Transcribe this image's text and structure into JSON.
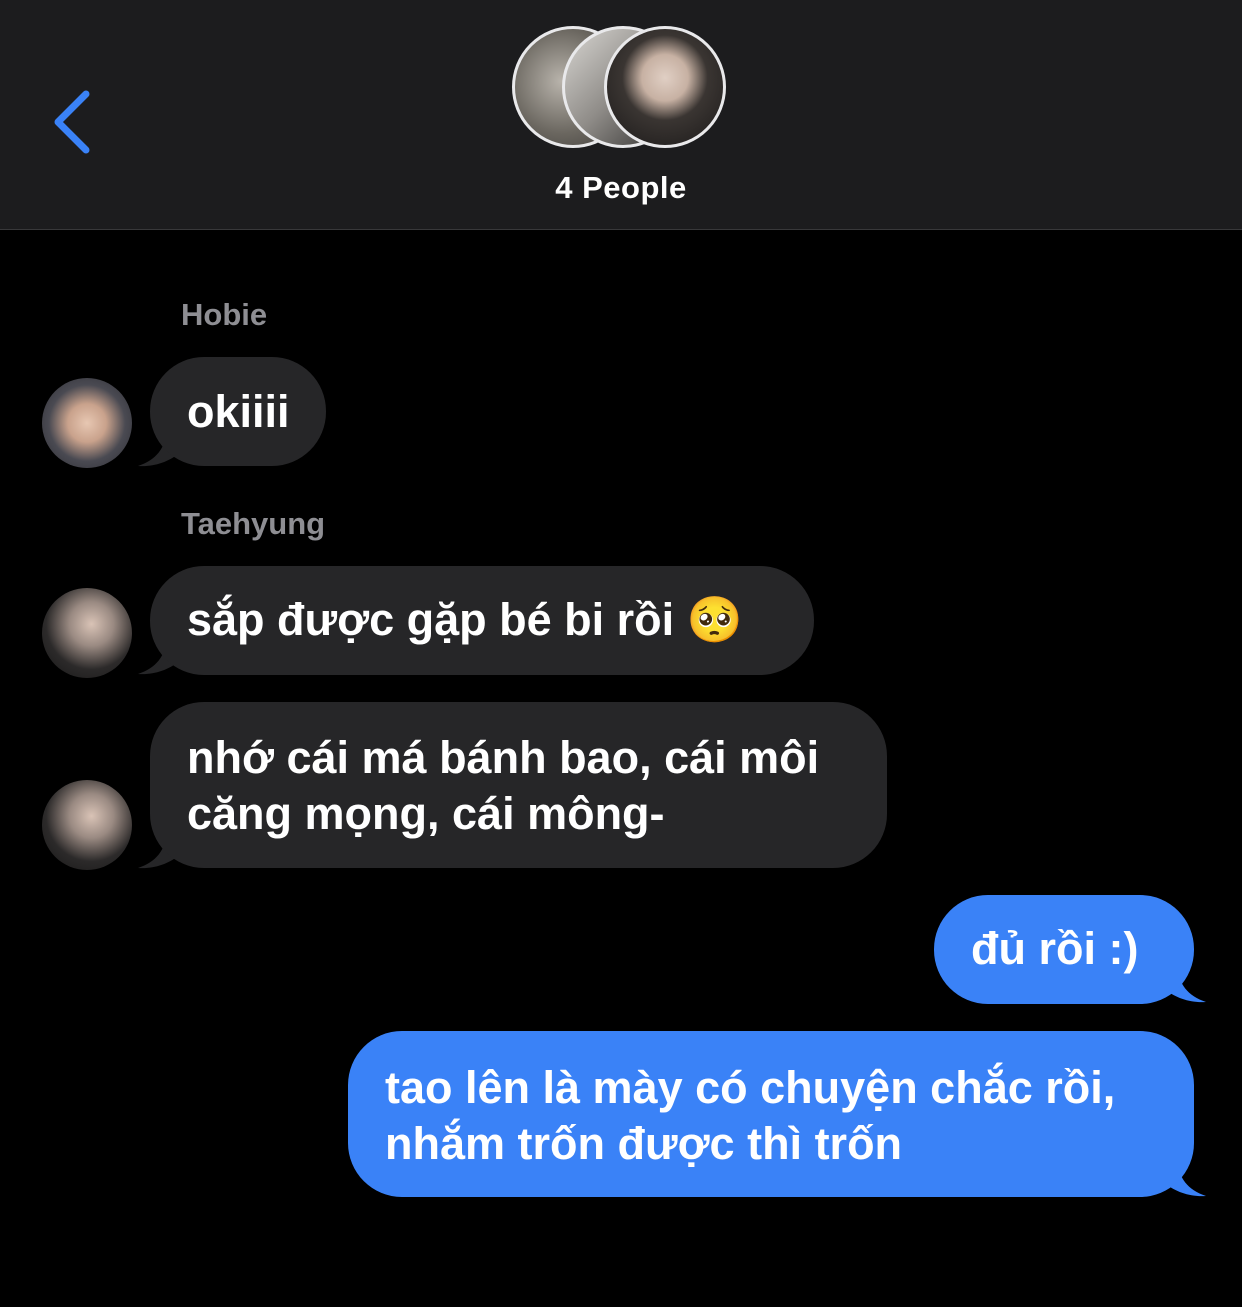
{
  "header": {
    "title": "4 People",
    "back_icon": "chevron-left-icon",
    "accent_color": "#3a82f7"
  },
  "messages": [
    {
      "sender": "Hobie",
      "text": "okiiii",
      "direction": "received"
    },
    {
      "sender": "Taehyung",
      "text": "sắp được gặp bé bi rồi 🥺",
      "direction": "received"
    },
    {
      "sender": "Taehyung",
      "text": "nhớ cái má bánh bao, cái môi\ncăng mọng, cái mông-",
      "direction": "received"
    },
    {
      "text": "đủ rồi :)",
      "direction": "sent"
    },
    {
      "text": "tao lên là mày có chuyện chắc rồi,\nnhắm trốn được thì trốn",
      "direction": "sent"
    }
  ],
  "colors": {
    "sent_bubble": "#3a82f7",
    "received_bubble": "#262628",
    "sender_name": "#8e8e93",
    "header_bg": "#1c1c1e"
  }
}
